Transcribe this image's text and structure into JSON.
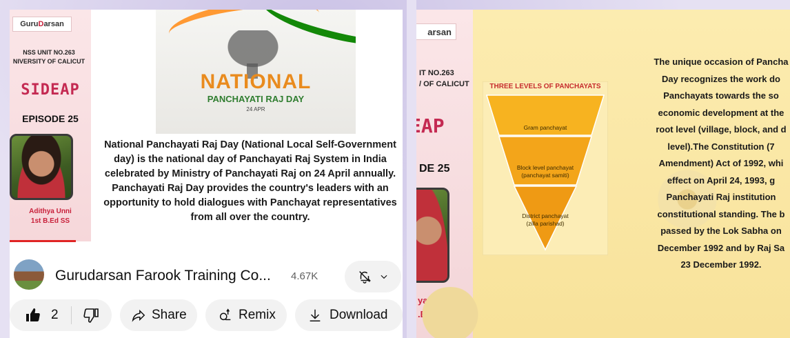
{
  "left": {
    "side_card": {
      "brand_prefix": "Guru",
      "brand_accent": "D",
      "brand_suffix": "arsan",
      "unit_line1": "NSS UNIT NO.263",
      "unit_line2": "NIVERSITY OF CALICUT",
      "series": "SIDEAP",
      "episode": "EPISODE 25",
      "person_name": "Adithya Unni",
      "person_class": "1st B.Ed SS"
    },
    "poster": {
      "title": "NATIONAL",
      "subtitle": "PANCHAYATI RAJ DAY",
      "date": "24 APR"
    },
    "description": "National Panchayati Raj Day (National Local Self-Government day) is the national day of Panchayati Raj System in India celebrated by Ministry of Panchayati Raj on 24 April annually. Panchayati Raj Day provides the country's leaders with an opportunity to hold dialogues with Panchayat representatives from all over the country.",
    "channel": {
      "name": "Gurudarsan Farook Training Co...",
      "subscribers": "4.67K"
    },
    "actions": {
      "like_count": "2",
      "share_label": "Share",
      "remix_label": "Remix",
      "download_label": "Download"
    }
  },
  "right": {
    "side": {
      "brand": "arsan",
      "unit_line1": "IT NO.263",
      "unit_line2": "/ OF CALICUT",
      "series": "EAP",
      "episode": "DE 25",
      "person_name": "ya Unni",
      "person_class": ".Ed SS"
    },
    "pyramid": {
      "title": "THREE LEVELS OF PANCHAYATS",
      "level1": "Gram panchayat",
      "level2_line1": "Block level panchayat",
      "level2_line2": "(panchayat samiti)",
      "level3_line1": "District panchayat",
      "level3_line2": "(zilla parishad)"
    },
    "text_lines": [
      "The unique occasion of Pancha",
      "Day recognizes the work do",
      "Panchayats towards the so",
      "economic development at the",
      "root level (village, block, and d",
      "level).The Constitution (7",
      "Amendment) Act of 1992, whi",
      "effect on April 24, 1993, g",
      "Panchayati Raj institution",
      "constitutional standing. The b",
      "passed by the Lok Sabha on",
      "December 1992 and by Raj Sa",
      "23 December 1992."
    ]
  }
}
